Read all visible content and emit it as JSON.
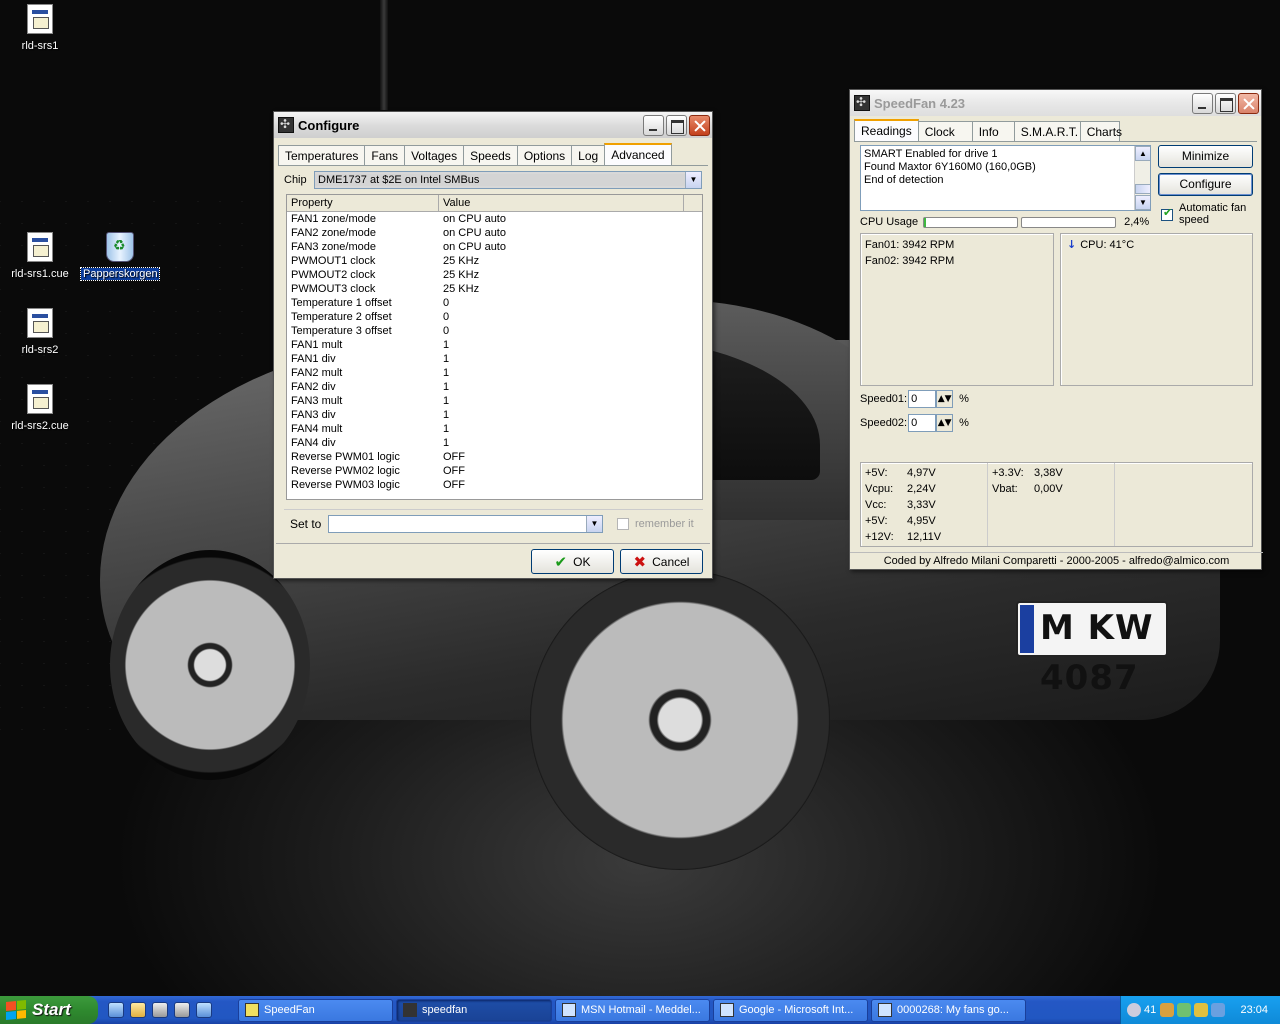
{
  "desktop": {
    "icons": [
      {
        "label": "rld-srs1",
        "name": "file-icon"
      },
      {
        "label": "rld-srs1.cue",
        "name": "file-icon"
      },
      {
        "label": "Papperskorgen",
        "name": "recycle-bin-icon"
      },
      {
        "label": "rld-srs2",
        "name": "file-icon"
      },
      {
        "label": "rld-srs2.cue",
        "name": "file-icon"
      }
    ],
    "plate_text": "M KW 4087"
  },
  "configure": {
    "title": "Configure",
    "tabs": [
      "Temperatures",
      "Fans",
      "Voltages",
      "Speeds",
      "Options",
      "Log",
      "Advanced"
    ],
    "selected_tab": "Advanced",
    "chip_label": "Chip",
    "chip_value": "DME1737 at $2E on Intel SMBus",
    "columns": [
      "Property",
      "Value"
    ],
    "rows": [
      [
        "FAN1 zone/mode",
        "on CPU auto"
      ],
      [
        "FAN2 zone/mode",
        "on CPU auto"
      ],
      [
        "FAN3 zone/mode",
        "on CPU auto"
      ],
      [
        "PWMOUT1 clock",
        "25 KHz"
      ],
      [
        "PWMOUT2 clock",
        "25 KHz"
      ],
      [
        "PWMOUT3 clock",
        "25 KHz"
      ],
      [
        "Temperature 1 offset",
        "0"
      ],
      [
        "Temperature 2 offset",
        "0"
      ],
      [
        "Temperature 3 offset",
        "0"
      ],
      [
        "FAN1 mult",
        "1"
      ],
      [
        "FAN1 div",
        "1"
      ],
      [
        "FAN2 mult",
        "1"
      ],
      [
        "FAN2 div",
        "1"
      ],
      [
        "FAN3 mult",
        "1"
      ],
      [
        "FAN3 div",
        "1"
      ],
      [
        "FAN4 mult",
        "1"
      ],
      [
        "FAN4 div",
        "1"
      ],
      [
        "Reverse PWM01 logic",
        "OFF"
      ],
      [
        "Reverse PWM02 logic",
        "OFF"
      ],
      [
        "Reverse PWM03 logic",
        "OFF"
      ]
    ],
    "set_to_label": "Set to",
    "set_to_value": "",
    "remember_label": "remember it",
    "ok_label": "OK",
    "cancel_label": "Cancel"
  },
  "speedfan": {
    "title": "SpeedFan 4.23",
    "tabs": [
      "Readings",
      "Clock",
      "Info",
      "S.M.A.R.T.",
      "Charts"
    ],
    "selected_tab": "Readings",
    "log_lines": [
      "SMART Enabled for drive 1",
      "Found Maxtor 6Y160M0 (160,0GB)",
      "End of detection"
    ],
    "minimize_label": "Minimize",
    "configure_label": "Configure",
    "auto_fan_label": "Automatic fan speed",
    "auto_fan_checked": true,
    "cpu_usage_label": "CPU Usage",
    "cpu_usage_pct": "2,4%",
    "cpu_usage_value": 0.024,
    "fans": [
      "Fan01: 3942 RPM",
      "Fan02: 3942 RPM"
    ],
    "temps": [
      "CPU: 41°C"
    ],
    "speeds": [
      {
        "label": "Speed01:",
        "value": "0",
        "unit": "%"
      },
      {
        "label": "Speed02:",
        "value": "0",
        "unit": "%"
      }
    ],
    "voltages_col1": [
      [
        "+5V:",
        "4,97V"
      ],
      [
        "Vcpu:",
        "2,24V"
      ],
      [
        "Vcc:",
        "3,33V"
      ],
      [
        "+5V:",
        "4,95V"
      ],
      [
        "+12V:",
        "12,11V"
      ]
    ],
    "voltages_col2": [
      [
        "+3.3V:",
        "3,38V"
      ],
      [
        "Vbat:",
        "0,00V"
      ]
    ],
    "credit": "Coded by Alfredo Milani Comparetti - 2000-2005 - alfredo@almico.com"
  },
  "taskbar": {
    "start_label": "Start",
    "tasks": [
      {
        "label": "SpeedFan",
        "active": false
      },
      {
        "label": "speedfan",
        "active": true
      },
      {
        "label": "MSN Hotmail - Meddel...",
        "active": false
      },
      {
        "label": "Google - Microsoft Int...",
        "active": false
      },
      {
        "label": "0000268: My fans go...",
        "active": false
      }
    ],
    "tray_temp": "41",
    "clock": "23:04"
  },
  "colors": {
    "taskbar": "#2457c4",
    "start": "#2f8a2f",
    "window_face": "#ece9d8",
    "cpu_bar": "#3fb83f"
  }
}
